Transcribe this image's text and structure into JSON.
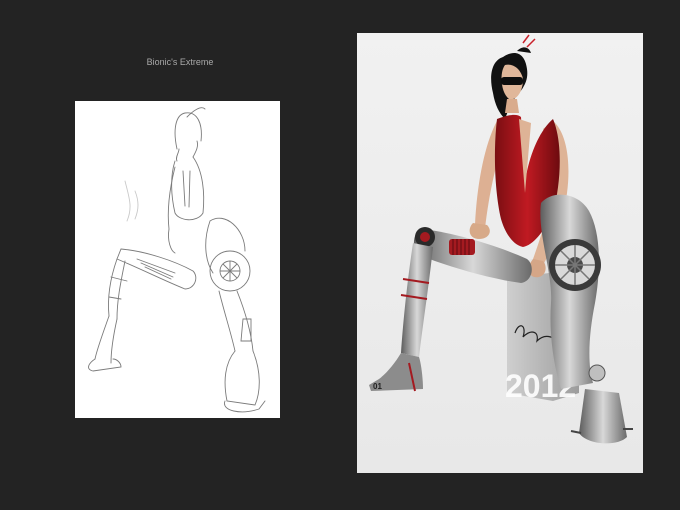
{
  "title": "Bionic's Extreme",
  "render": {
    "year_label": "2012",
    "leg_number": "01"
  }
}
